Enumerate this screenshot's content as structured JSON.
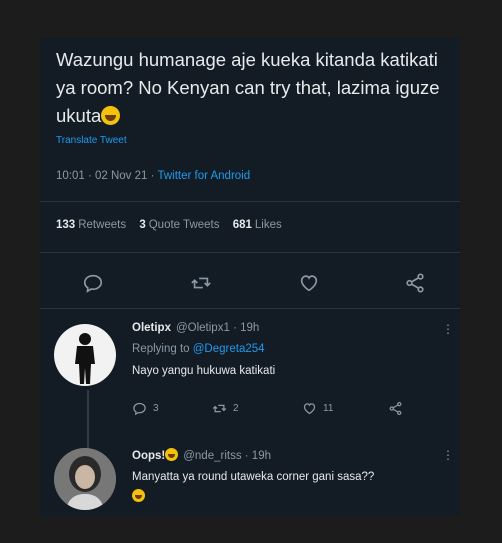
{
  "tweet": {
    "text": "Wazungu humanage aje kueka kitanda katikati ya room? No Kenyan can try that, lazima iguze ukuta",
    "translate_label": "Translate Tweet",
    "time": "10:01 · 02 Nov 21",
    "source": "Twitter for Android",
    "stats": {
      "retweets_count": "133",
      "retweets_label": "Retweets",
      "quotes_count": "3",
      "quotes_label": "Quote Tweets",
      "likes_count": "681",
      "likes_label": "Likes"
    }
  },
  "replies": [
    {
      "name": "Oletipx",
      "handle": "@Oletipx1",
      "time": "· 19h",
      "replying_prefix": "Replying to",
      "replying_to": "@Degreta254",
      "text": "Nayo yangu hukuwa katikati",
      "reply_count": "3",
      "retweet_count": "2",
      "like_count": "11"
    },
    {
      "name": "Oops!",
      "handle": "@nde_ritss",
      "time": "· 19h",
      "text": "Manyatta ya round utaweka corner gani sasa??"
    }
  ],
  "colors": {
    "background": "#131c25",
    "accent": "#1d9bf0",
    "text": "#e7e9ea",
    "muted": "#8b98a5"
  }
}
